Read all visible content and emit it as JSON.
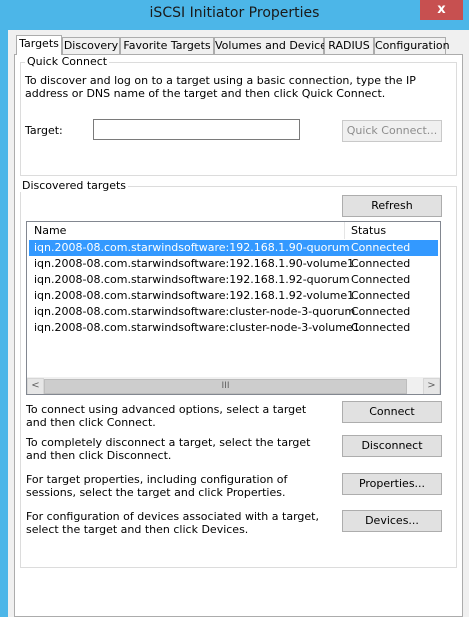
{
  "window": {
    "title": "iSCSI Initiator Properties",
    "close_glyph": "x"
  },
  "tabs": [
    {
      "label": "Targets",
      "active": true
    },
    {
      "label": "Discovery"
    },
    {
      "label": "Favorite Targets"
    },
    {
      "label": "Volumes and Devices"
    },
    {
      "label": "RADIUS"
    },
    {
      "label": "Configuration"
    }
  ],
  "quick_connect": {
    "group_label": "Quick Connect",
    "description": "To discover and log on to a target using a basic connection, type the IP address or DNS name of the target and then click Quick Connect.",
    "target_label": "Target:",
    "target_value": "",
    "quick_connect_button": "Quick Connect..."
  },
  "discovered": {
    "group_label": "Discovered targets",
    "refresh_button": "Refresh",
    "columns": {
      "name": "Name",
      "status": "Status"
    },
    "rows": [
      {
        "name": "iqn.2008-08.com.starwindsoftware:192.168.1.90-quorum",
        "status": "Connected",
        "selected": true
      },
      {
        "name": "iqn.2008-08.com.starwindsoftware:192.168.1.90-volume1",
        "status": "Connected"
      },
      {
        "name": "iqn.2008-08.com.starwindsoftware:192.168.1.92-quorum",
        "status": "Connected"
      },
      {
        "name": "iqn.2008-08.com.starwindsoftware:192.168.1.92-volume1",
        "status": "Connected"
      },
      {
        "name": "iqn.2008-08.com.starwindsoftware:cluster-node-3-quorum",
        "status": "Connected"
      },
      {
        "name": "iqn.2008-08.com.starwindsoftware:cluster-node-3-volume1",
        "status": "Connected"
      }
    ],
    "scroll_left": "<",
    "scroll_right": ">",
    "scroll_grip": "III"
  },
  "actions": {
    "connect_text": "To connect using advanced options, select a target and then click Connect.",
    "connect_button": "Connect",
    "disconnect_text": "To completely disconnect a target, select the target and then click Disconnect.",
    "disconnect_button": "Disconnect",
    "properties_text": "For target properties, including configuration of sessions, select the target and click Properties.",
    "properties_button": "Properties...",
    "devices_text": "For configuration of devices associated with a target, select the target and then click Devices.",
    "devices_button": "Devices..."
  },
  "colors": {
    "titlebar": "#4cb6e8",
    "close_button": "#c75050",
    "selection": "#3399ff"
  }
}
